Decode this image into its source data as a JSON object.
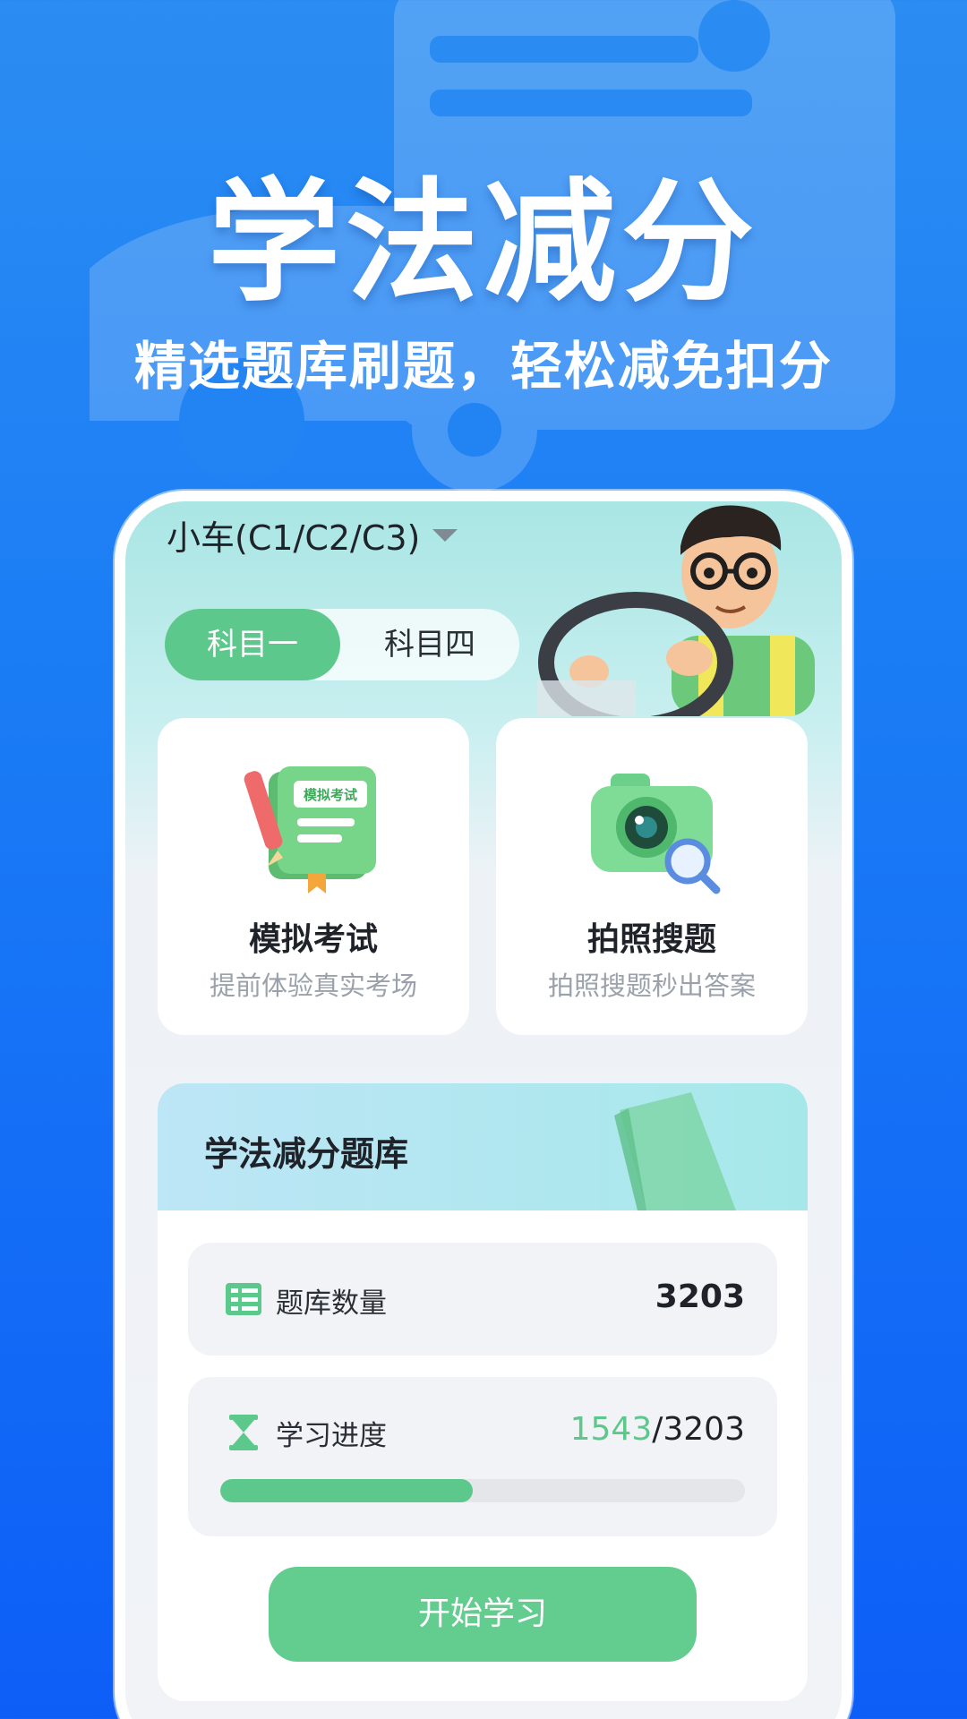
{
  "hero": {
    "title": "学法减分",
    "subtitle": "精选题库刷题，轻松减免扣分"
  },
  "vehicle_selector": {
    "label": "小车(C1/C2/C3)",
    "icon": "caret-down-icon"
  },
  "subject_tabs": {
    "active": "科目一",
    "inactive": "科目四"
  },
  "features": [
    {
      "title": "模拟考试",
      "desc": "提前体验真实考场",
      "icon": "exam-book-icon",
      "icon_text": "模拟考试"
    },
    {
      "title": "拍照搜题",
      "desc": "拍照搜题秒出答案",
      "icon": "camera-search-icon"
    }
  ],
  "bank": {
    "title": "学法减分题库",
    "count_label": "题库数量",
    "count_value": "3203",
    "progress_label": "学习进度",
    "progress_done": "1543",
    "progress_sep": "/",
    "progress_total": "3203",
    "progress_fraction": 0.482,
    "start_label": "开始学习"
  },
  "colors": {
    "accent_green": "#5dc88c",
    "background_blue": "#1a7cf5"
  }
}
